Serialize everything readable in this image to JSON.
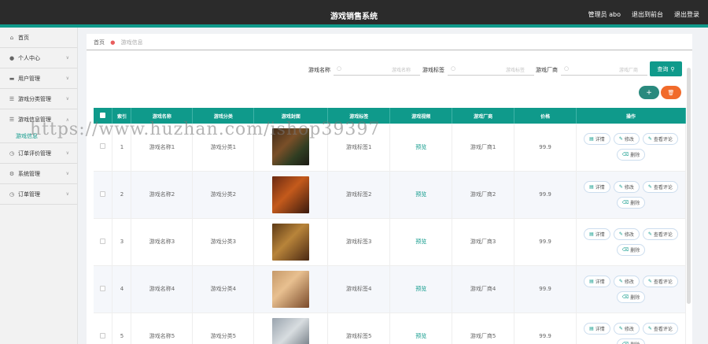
{
  "header": {
    "title": "游戏销售系统",
    "admin": "管理员 abo",
    "back": "退出到前台",
    "logout": "退出登录"
  },
  "sidebar": {
    "items": [
      {
        "label": "首页",
        "icon": "home-icon",
        "chev": false
      },
      {
        "label": "个人中心",
        "icon": "user-icon",
        "chev": true
      },
      {
        "label": "用户管理",
        "icon": "folder-icon",
        "chev": true
      },
      {
        "label": "游戏分类管理",
        "icon": "list-icon",
        "chev": true
      },
      {
        "label": "游戏信息管理",
        "icon": "list-icon",
        "chev": true,
        "open": true
      },
      {
        "label": "订单评价管理",
        "icon": "clock-icon",
        "chev": true
      },
      {
        "label": "系统管理",
        "icon": "settings-icon",
        "chev": true
      },
      {
        "label": "订单管理",
        "icon": "clock-icon",
        "chev": true
      }
    ],
    "subitem": "游戏信息"
  },
  "breadcrumb": {
    "home": "首页",
    "current": "游戏信息"
  },
  "search": {
    "name_label": "游戏名称",
    "name_placeholder": "游戏名称",
    "tag_label": "游戏标签",
    "tag_placeholder": "游戏标签",
    "vendor_label": "游戏厂商",
    "vendor_placeholder": "游戏厂商",
    "query": "查询"
  },
  "table": {
    "headers": [
      "索引",
      "游戏名称",
      "游戏分类",
      "游戏封面",
      "游戏标签",
      "游戏视频",
      "游戏厂商",
      "价格",
      "操作"
    ],
    "rows": [
      {
        "index": "1",
        "name": "游戏名称1",
        "category": "游戏分类1",
        "tag": "游戏标签1",
        "video": "预览",
        "vendor": "游戏厂商1",
        "price": "99.9"
      },
      {
        "index": "2",
        "name": "游戏名称2",
        "category": "游戏分类2",
        "tag": "游戏标签2",
        "video": "预览",
        "vendor": "游戏厂商2",
        "price": "99.9"
      },
      {
        "index": "3",
        "name": "游戏名称3",
        "category": "游戏分类3",
        "tag": "游戏标签3",
        "video": "预览",
        "vendor": "游戏厂商3",
        "price": "99.9"
      },
      {
        "index": "4",
        "name": "游戏名称4",
        "category": "游戏分类4",
        "tag": "游戏标签4",
        "video": "预览",
        "vendor": "游戏厂商4",
        "price": "99.9"
      },
      {
        "index": "5",
        "name": "游戏名称5",
        "category": "游戏分类5",
        "tag": "游戏标签5",
        "video": "预览",
        "vendor": "游戏厂商5",
        "price": "99.9"
      }
    ],
    "actions": {
      "detail": "详情",
      "edit": "修改",
      "review": "查看评论",
      "delete": "删除"
    }
  },
  "watermark": "https://www.huzhan.com/ishop39397",
  "colors": {
    "primary": "#0f9a8b",
    "danger": "#f16b2b",
    "header": "#2b2b2b"
  }
}
